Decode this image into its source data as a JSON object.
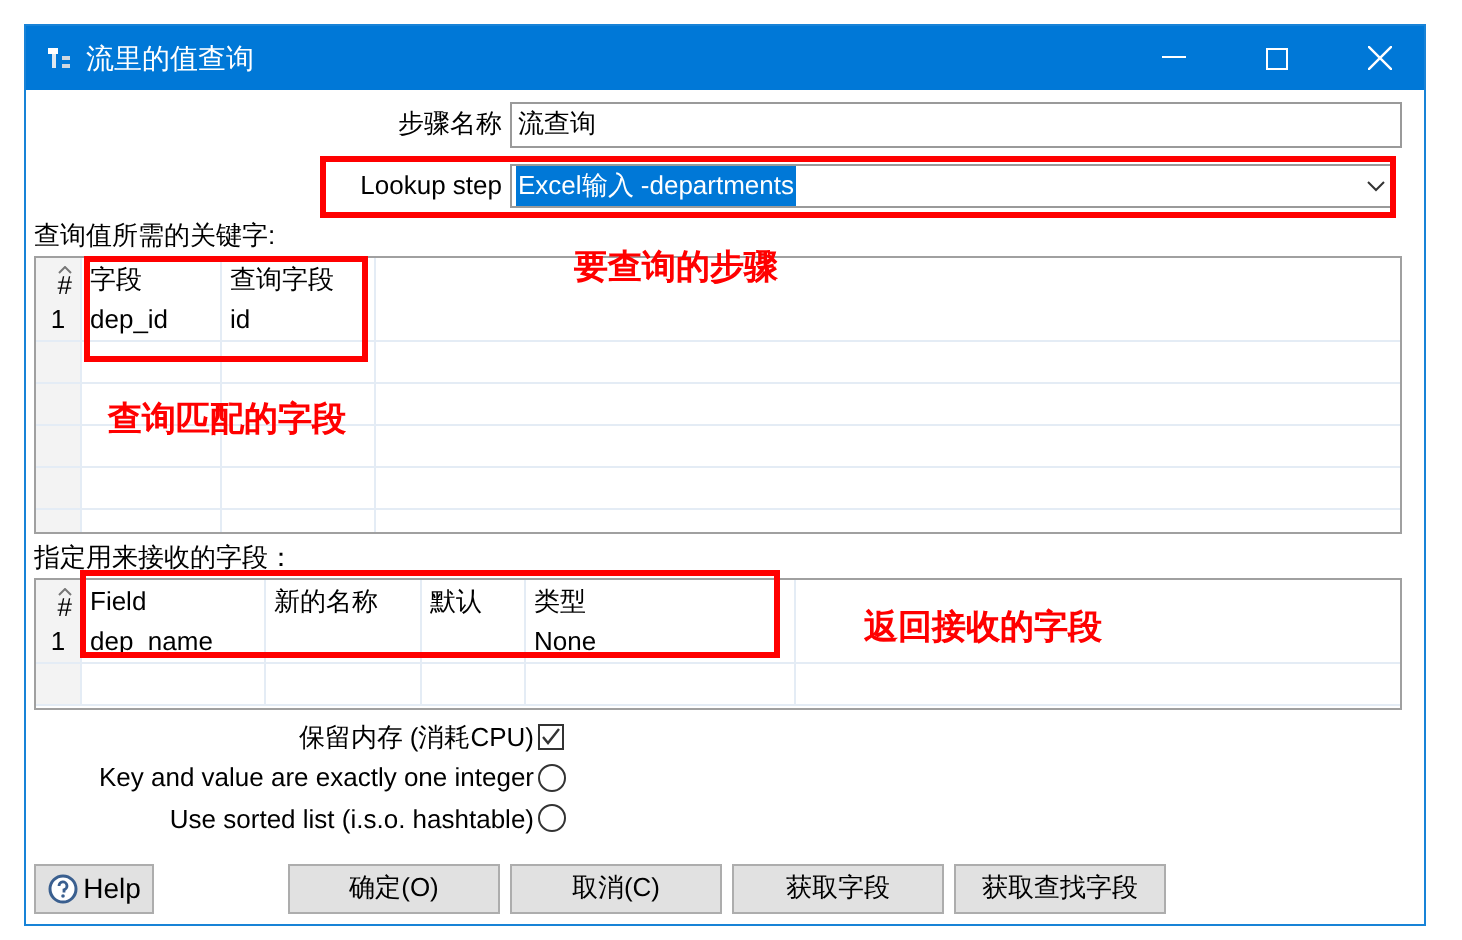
{
  "window": {
    "title": "流里的值查询"
  },
  "step_name": {
    "label": "步骤名称",
    "value": "流查询"
  },
  "lookup_step": {
    "label": "Lookup step",
    "value": "Excel输入 -departments"
  },
  "key_table": {
    "label": "查询值所需的关键字:",
    "columns": [
      "#",
      "字段",
      "查询字段"
    ],
    "rows": [
      [
        "1",
        "dep_id",
        "id"
      ]
    ]
  },
  "return_table": {
    "label": "指定用来接收的字段：",
    "columns": [
      "#",
      "Field",
      "新的名称",
      "默认",
      "类型"
    ],
    "rows": [
      [
        "1",
        "dep_name",
        "",
        "",
        "None"
      ]
    ]
  },
  "options": [
    {
      "kind": "checkbox",
      "label": "保留内存 (消耗CPU)",
      "checked": true
    },
    {
      "kind": "radio",
      "label": "Key and value are exactly one integer",
      "checked": false
    },
    {
      "kind": "radio",
      "label": "Use sorted list (i.s.o. hashtable)",
      "checked": false
    }
  ],
  "buttons": [
    {
      "kind": "help",
      "label": "Help"
    },
    {
      "kind": "plain",
      "label": "确定(O)"
    },
    {
      "kind": "plain",
      "label": "取消(C)"
    },
    {
      "kind": "plain",
      "label": "获取字段"
    },
    {
      "kind": "plain",
      "label": "获取查找字段"
    }
  ],
  "annotations": [
    "要查询的步骤",
    "查询匹配的字段",
    "返回接收的字段"
  ]
}
